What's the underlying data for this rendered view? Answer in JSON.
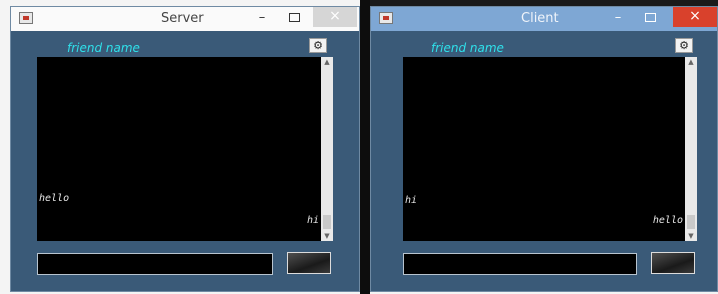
{
  "server": {
    "title": "Server",
    "friend_name": "friend name",
    "chat_messages": {
      "left": "hello",
      "right": "hi"
    },
    "input_value": "",
    "controls": {
      "minimize": "–",
      "maximize": "",
      "close": "×"
    }
  },
  "client": {
    "title": "Client",
    "friend_name": "friend name",
    "chat_messages": {
      "left": "hi",
      "right": "hello"
    },
    "input_value": "",
    "controls": {
      "minimize": "–",
      "maximize": "",
      "close": "×"
    }
  },
  "icons": {
    "app": "app-icon",
    "settings": "gear-icon",
    "scroll_up": "scroll-up-arrow-icon",
    "scroll_down": "scroll-down-arrow-icon"
  },
  "colors": {
    "window_bg": "#3a5a78",
    "friend_name": "#2fe0ea",
    "client_titlebar": "#7ea7d4",
    "close_active": "#d9412c"
  }
}
